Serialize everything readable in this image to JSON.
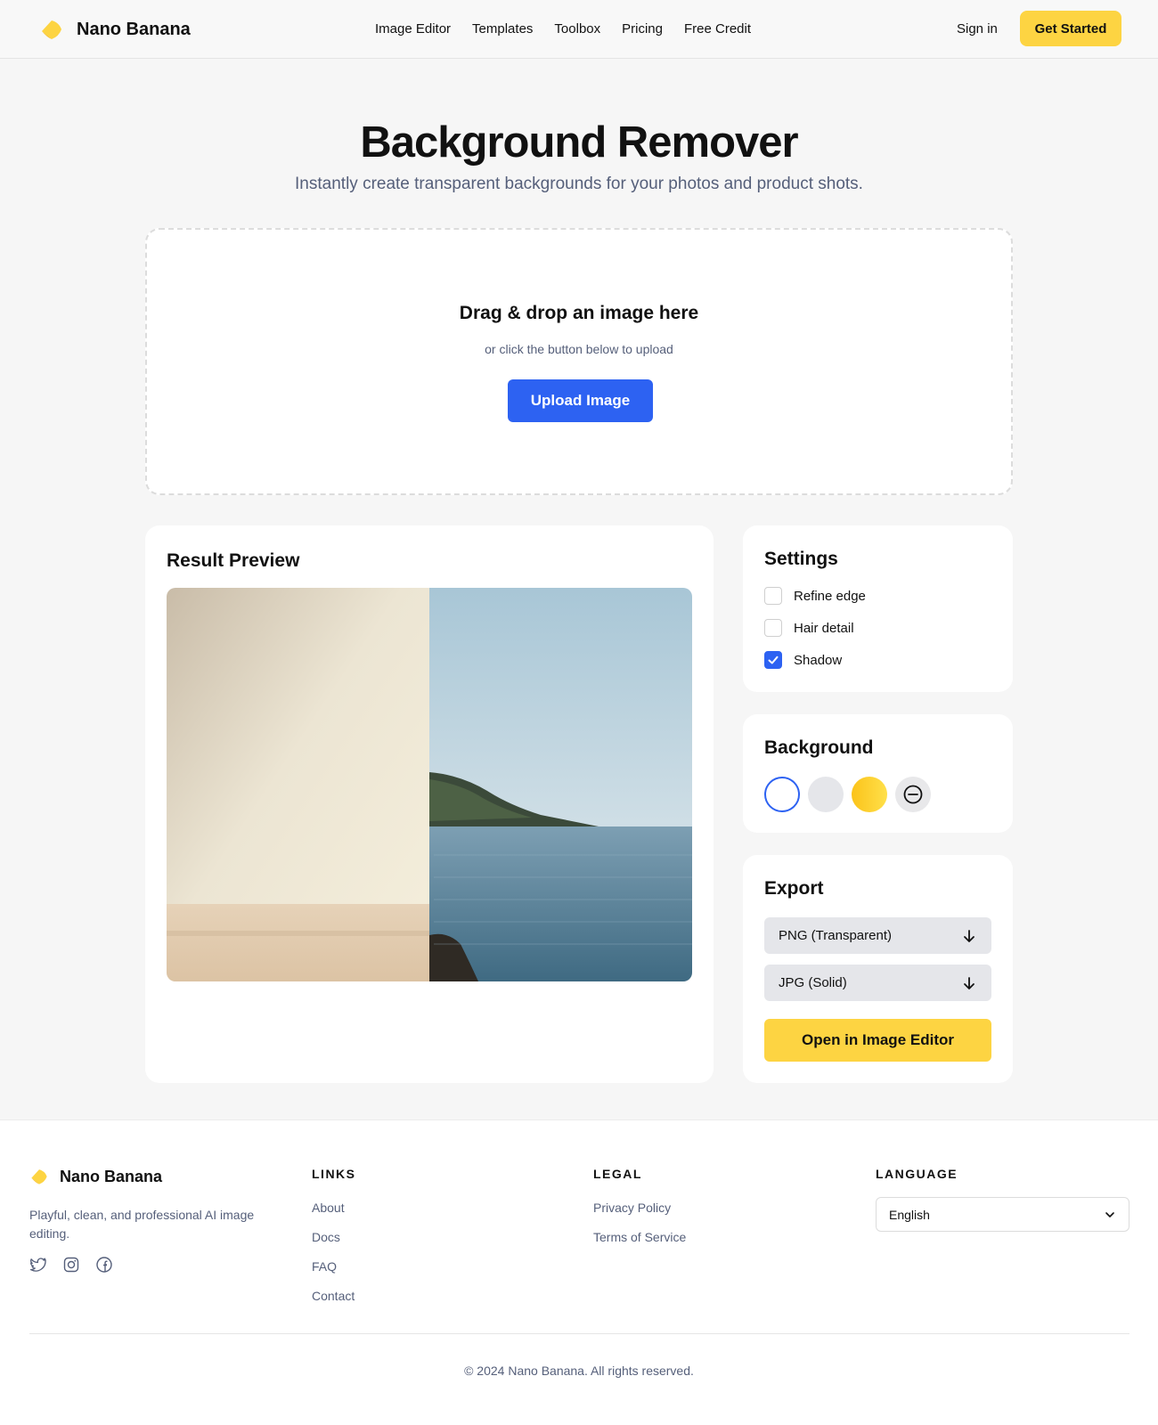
{
  "brand": {
    "name": "Nano Banana",
    "accent": "#fdd442",
    "primary": "#2d62f2"
  },
  "nav": {
    "items": [
      {
        "label": "Image Editor"
      },
      {
        "label": "Templates"
      },
      {
        "label": "Toolbox"
      },
      {
        "label": "Pricing"
      },
      {
        "label": "Free Credit"
      }
    ],
    "signin": "Sign in",
    "get_started": "Get Started"
  },
  "hero": {
    "title": "Background Remover",
    "subtitle": "Instantly create transparent backgrounds for your photos and product shots."
  },
  "upload": {
    "title": "Drag & drop an image here",
    "subtitle": "or click the button below to upload",
    "button": "Upload Image"
  },
  "result": {
    "title": "Result Preview"
  },
  "settings": {
    "title": "Settings",
    "options": [
      {
        "label": "Refine edge",
        "checked": false
      },
      {
        "label": "Hair detail",
        "checked": false
      },
      {
        "label": "Shadow",
        "checked": true
      }
    ]
  },
  "background": {
    "title": "Background",
    "swatches": [
      {
        "name": "white",
        "color": "#ffffff",
        "selected": true
      },
      {
        "name": "gray",
        "color": "#e5e6ea",
        "selected": false
      },
      {
        "name": "yellow",
        "color": "#fdd442",
        "selected": false
      },
      {
        "name": "none",
        "icon": "minus-circle-icon",
        "selected": false
      }
    ]
  },
  "export": {
    "title": "Export",
    "options": [
      {
        "label": "PNG (Transparent)",
        "icon": "arrow-down-icon"
      },
      {
        "label": "JPG (Solid)",
        "icon": "arrow-down-icon"
      }
    ],
    "open_editor": "Open in Image Editor"
  },
  "footer": {
    "brand": "Nano Banana",
    "tagline": "Playful, clean, and professional AI image editing.",
    "social": [
      "twitter-icon",
      "instagram-icon",
      "facebook-icon"
    ],
    "links": {
      "heading": "LINKS",
      "items": [
        "About",
        "Docs",
        "FAQ",
        "Contact"
      ]
    },
    "legal": {
      "heading": "LEGAL",
      "items": [
        "Privacy Policy",
        "Terms of Service"
      ]
    },
    "language": {
      "heading": "LANGUAGE",
      "value": "English"
    },
    "copyright": "© 2024 Nano Banana. All rights reserved."
  }
}
